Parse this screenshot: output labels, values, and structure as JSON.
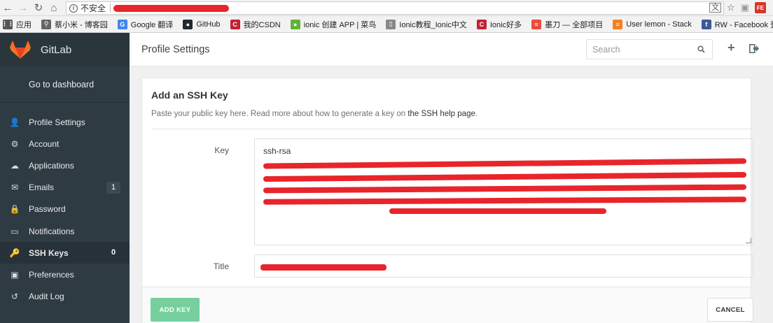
{
  "browser": {
    "security_label": "不安全",
    "bookmarks": [
      {
        "label": "应用",
        "icon": "apps-grid-icon",
        "color": "#555555"
      },
      {
        "label": "蔡小米 - 博客园",
        "icon": "bookmark-icon",
        "color": "#666666"
      },
      {
        "label": "Google 翻译",
        "icon": "google-translate-icon",
        "color": "#4285f4"
      },
      {
        "label": "GitHub",
        "icon": "github-icon",
        "color": "#24292e"
      },
      {
        "label": "我的CSDN",
        "icon": "csdn-icon",
        "color": "#c32136"
      },
      {
        "label": "ionic 创建 APP | 菜鸟",
        "icon": "runoob-icon",
        "color": "#5fb336"
      },
      {
        "label": "Ionic教程_Ionic中文",
        "icon": "page-icon",
        "color": "#888888"
      },
      {
        "label": "Ionic好多",
        "icon": "csdn-icon",
        "color": "#c32136"
      },
      {
        "label": "墨刀 — 全部项目",
        "icon": "modao-icon",
        "color": "#e94b3c"
      },
      {
        "label": "User lemon - Stack",
        "icon": "stackoverflow-icon",
        "color": "#f48024"
      },
      {
        "label": "RW - Facebook 登录",
        "icon": "facebook-icon",
        "color": "#3b5998"
      }
    ]
  },
  "sidebar": {
    "brand": "GitLab",
    "dashboard_link": "Go to dashboard",
    "items": [
      {
        "label": "Profile Settings",
        "icon": "user-icon",
        "glyph": "👤",
        "badge": null,
        "active": false
      },
      {
        "label": "Account",
        "icon": "gear-icon",
        "glyph": "⚙",
        "badge": null,
        "active": false
      },
      {
        "label": "Applications",
        "icon": "cloud-icon",
        "glyph": "☁",
        "badge": null,
        "active": false
      },
      {
        "label": "Emails",
        "icon": "envelope-icon",
        "glyph": "✉",
        "badge": "1",
        "active": false
      },
      {
        "label": "Password",
        "icon": "lock-icon",
        "glyph": "🔒",
        "badge": null,
        "active": false
      },
      {
        "label": "Notifications",
        "icon": "inbox-icon",
        "glyph": "▭",
        "badge": null,
        "active": false
      },
      {
        "label": "SSH Keys",
        "icon": "key-icon",
        "glyph": "🔑",
        "badge": "0",
        "active": true
      },
      {
        "label": "Preferences",
        "icon": "image-icon",
        "glyph": "▣",
        "badge": null,
        "active": false
      },
      {
        "label": "Audit Log",
        "icon": "history-icon",
        "glyph": "↺",
        "badge": null,
        "active": false
      }
    ]
  },
  "header": {
    "title": "Profile Settings",
    "search_placeholder": "Search"
  },
  "form": {
    "heading": "Add an SSH Key",
    "description_prefix": "Paste your public key here. Read more about how to generate a key on ",
    "description_link": "the SSH help page",
    "description_suffix": ".",
    "key_label": "Key",
    "key_value_prefix": "ssh-rsa",
    "title_label": "Title",
    "submit_label": "ADD KEY",
    "cancel_label": "CANCEL"
  },
  "colors": {
    "sidebar_bg": "#2e3b42",
    "accent_green": "#76cf9c",
    "redaction": "#e8252b"
  }
}
